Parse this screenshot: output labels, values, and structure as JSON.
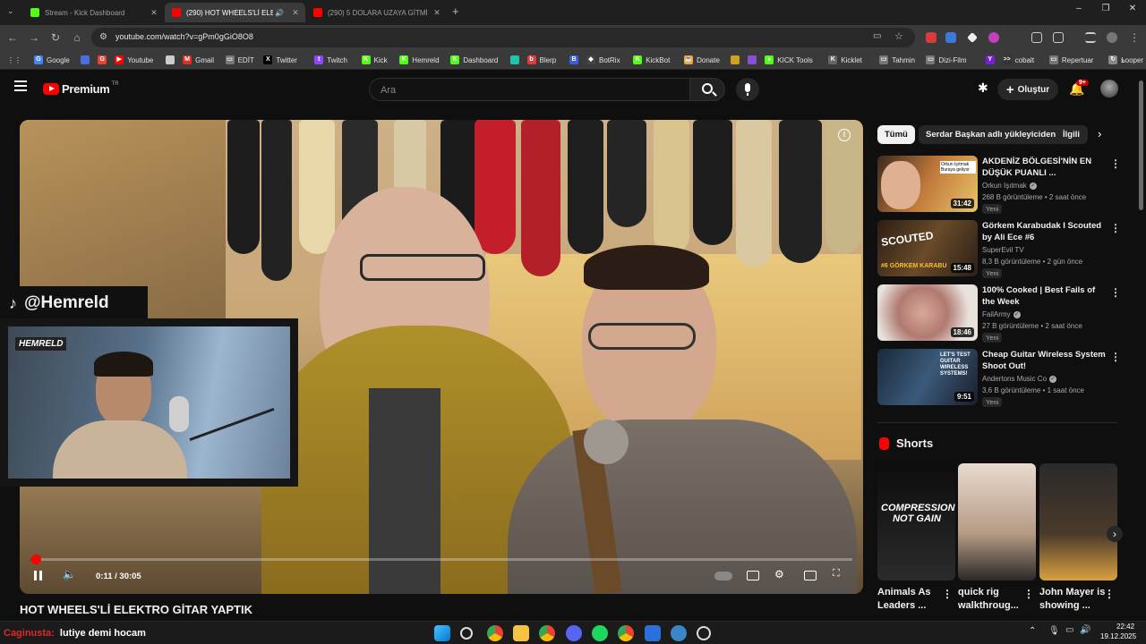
{
  "browser": {
    "tabs": [
      {
        "title": "Stream - Kick Dashboard",
        "active": false,
        "color": "#53fc18"
      },
      {
        "title": "(290) HOT WHEELS'Lİ ELEKT",
        "active": true,
        "color": "#ff0000"
      },
      {
        "title": "(290) 5 DOLARA UZAYA GİTMİ",
        "active": false,
        "color": "#ff0000"
      }
    ],
    "new_tab": "+",
    "url": "youtube.com/watch?v=gPm0gGiO8O8",
    "window_controls": {
      "minimize": "–",
      "maximize": "❐",
      "close": "✕"
    }
  },
  "bookmarks": [
    {
      "label": "Google",
      "color": "#4285f4",
      "glyph": "G"
    },
    {
      "label": "",
      "color": "#4a6ee0",
      "glyph": ""
    },
    {
      "label": "",
      "color": "#ea4335",
      "glyph": "G"
    },
    {
      "label": "Youtube",
      "color": "#ff0000",
      "glyph": "▶"
    },
    {
      "label": "",
      "color": "#cccccc",
      "glyph": ""
    },
    {
      "label": "Gmail",
      "color": "#d93025",
      "glyph": "M"
    },
    {
      "label": "EDİT",
      "color": "#777777",
      "glyph": "▭"
    },
    {
      "label": "Twitter",
      "color": "#000000",
      "glyph": "X"
    },
    {
      "label": "Twitch",
      "color": "#9146ff",
      "glyph": "t"
    },
    {
      "label": "Kick",
      "color": "#53fc18",
      "glyph": "K"
    },
    {
      "label": "Hemreld",
      "color": "#53fc18",
      "glyph": "K"
    },
    {
      "label": "Dashboard",
      "color": "#53fc18",
      "glyph": "K"
    },
    {
      "label": "",
      "color": "#22c3a6",
      "glyph": ""
    },
    {
      "label": "Blerp",
      "color": "#e03e3e",
      "glyph": "b"
    },
    {
      "label": "",
      "color": "#3e5ce0",
      "glyph": "B"
    },
    {
      "label": "BotRix",
      "color": "#444444",
      "glyph": "◆"
    },
    {
      "label": "KickBot",
      "color": "#53fc18",
      "glyph": "K"
    },
    {
      "label": "Donate",
      "color": "#f2a23a",
      "glyph": "☕"
    },
    {
      "label": "",
      "color": "#d0a020",
      "glyph": ""
    },
    {
      "label": "",
      "color": "#8a4fd8",
      "glyph": ""
    },
    {
      "label": "KICK Tools",
      "color": "#53fc18",
      "glyph": "●"
    },
    {
      "label": "Kicklet",
      "color": "#666666",
      "glyph": "K"
    },
    {
      "label": "Tahmin",
      "color": "#777777",
      "glyph": "▭"
    },
    {
      "label": "Dizi-Film",
      "color": "#777777",
      "glyph": "▭"
    },
    {
      "label": "",
      "color": "#7a1fd8",
      "glyph": "Y"
    },
    {
      "label": "cobalt",
      "color": "#333333",
      "glyph": ">>"
    },
    {
      "label": "Repertuar",
      "color": "#777777",
      "glyph": "▭"
    },
    {
      "label": "Looper",
      "color": "#888888",
      "glyph": "↻"
    }
  ],
  "youtube": {
    "logo_text": "Premium",
    "logo_sup": "TR",
    "search_placeholder": "Ara",
    "create_label": "Oluştur",
    "notif_count": "9+",
    "player": {
      "time": "0:11 / 30:05",
      "progress": 0.006
    },
    "video_title": "HOT WHEELS'Lİ ELEKTRO GİTAR YAPTIK",
    "chips": [
      "Tümü",
      "Serdar Başkan adlı yükleyiciden",
      "İlgili"
    ],
    "recommendations": [
      {
        "title": "AKDENİZ BÖLGESİ'NİN EN DÜŞÜK PUANLI ...",
        "channel": "Orkun Işıtmak",
        "verified": true,
        "meta": "268 B görüntüleme • 2 saat önce",
        "badge": "Yeni",
        "duration": "31:42"
      },
      {
        "title": "Görkem Karabudak I Scouted by Ali Ece #6",
        "channel": "SuperEvil TV",
        "verified": false,
        "meta": "8,3 B görüntüleme • 2 gün önce",
        "badge": "Yeni",
        "duration": "15:48"
      },
      {
        "title": "100% Cooked | Best Fails of the Week",
        "channel": "FailArmy",
        "verified": true,
        "meta": "27 B görüntüleme • 2 saat önce",
        "badge": "Yeni",
        "duration": "18:46"
      },
      {
        "title": "Cheap Guitar Wireless System Shoot Out!",
        "channel": "Andertons Music Co",
        "verified": true,
        "meta": "3,6 B görüntüleme • 1 saat önce",
        "badge": "Yeni",
        "duration": "9:51"
      }
    ],
    "thumb_texts": [
      "Orkun Işıtmak Buraya geliyor",
      "SCOUTED",
      "#6 GÖRKEM KARABU",
      "LET'S TEST GUITAR WIRELESS SYSTEMS!"
    ],
    "shorts_header": "Shorts",
    "shorts": [
      {
        "title": "Animals As Leaders ...",
        "thumb_text": "COMPRESSION NOT GAIN"
      },
      {
        "title": "quick rig walkthroug...",
        "thumb_text": ""
      },
      {
        "title": "John Mayer is showing ...",
        "thumb_text": ""
      }
    ]
  },
  "overlay": {
    "tiktok_handle": "@Hemreld",
    "cam_logo": "HEMRELD"
  },
  "taskbar": {
    "chat_user": "Caginusta:",
    "chat_message": "lutiye demi hocam",
    "time": "22:42",
    "date": "19.12.2025"
  }
}
